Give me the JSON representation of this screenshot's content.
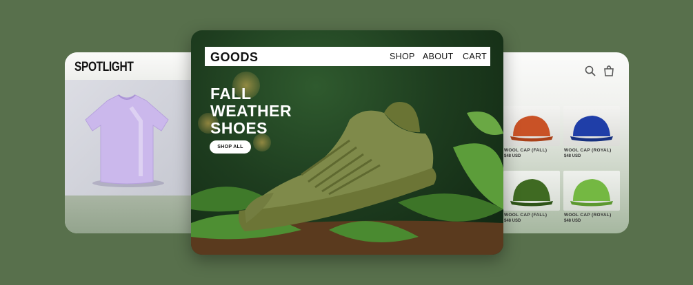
{
  "spotlight": {
    "title": "SPOTLIGHT"
  },
  "main": {
    "logo": "GOODS",
    "nav": [
      "SHOP",
      "ABOUT",
      "CART"
    ],
    "hero_lines": [
      "FALL",
      "WEATHER",
      "SHOES"
    ],
    "cta": "SHOP ALL"
  },
  "shop": {
    "products": [
      {
        "name": "WOOL CAP (FALL)",
        "price": "$48 USD",
        "color": "#c95226"
      },
      {
        "name": "WOOL CAP (ROYAL)",
        "price": "$48 USD",
        "color": "#1f3ea8"
      },
      {
        "name": "WOOL CAP (FALL)",
        "price": "$48 USD",
        "color": "#3f6a22"
      },
      {
        "name": "WOOL CAP (ROYAL)",
        "price": "$48 USD",
        "color": "#74b842"
      }
    ]
  },
  "colors": {
    "background": "#58704c",
    "tee": "#c9b8ea",
    "shoe": "#7f8a4a"
  }
}
